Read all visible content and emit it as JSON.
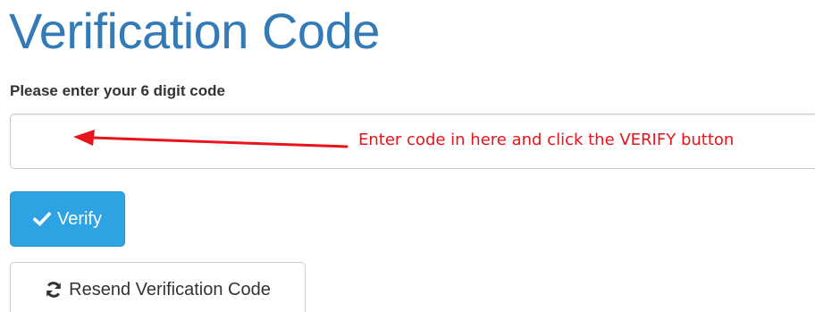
{
  "page": {
    "title": "Verification Code"
  },
  "form": {
    "label": "Please enter your 6 digit code",
    "code_value": "",
    "code_placeholder": ""
  },
  "annotation": {
    "text": "Enter code in here and click the VERIFY button",
    "color": "#e8141b"
  },
  "buttons": {
    "verify_label": "Verify",
    "verify_icon": "checkmark-icon",
    "resend_label": "Resend Verification Code",
    "resend_icon": "refresh-icon"
  },
  "colors": {
    "title": "#337ab7",
    "primary_button": "#2ea3e3",
    "text": "#333333"
  }
}
